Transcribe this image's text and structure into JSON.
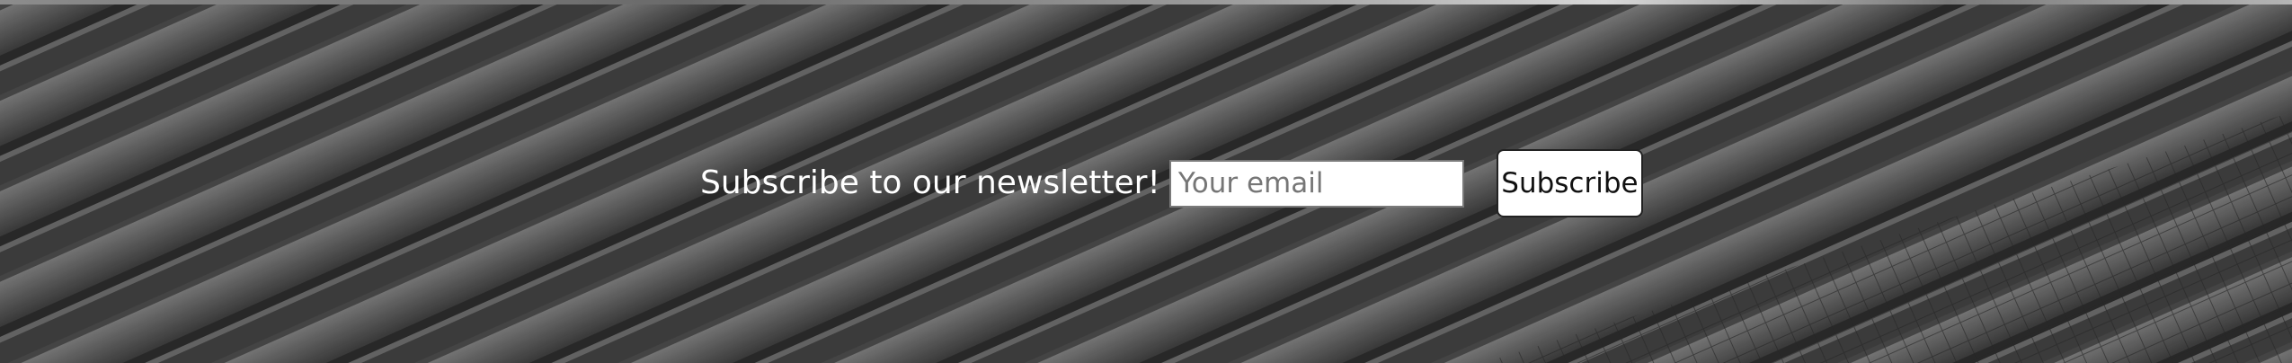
{
  "newsletter": {
    "heading": "Subscribe to our newsletter!",
    "email_placeholder": "Your email",
    "email_value": "",
    "subscribe_label": "Subscribe"
  }
}
